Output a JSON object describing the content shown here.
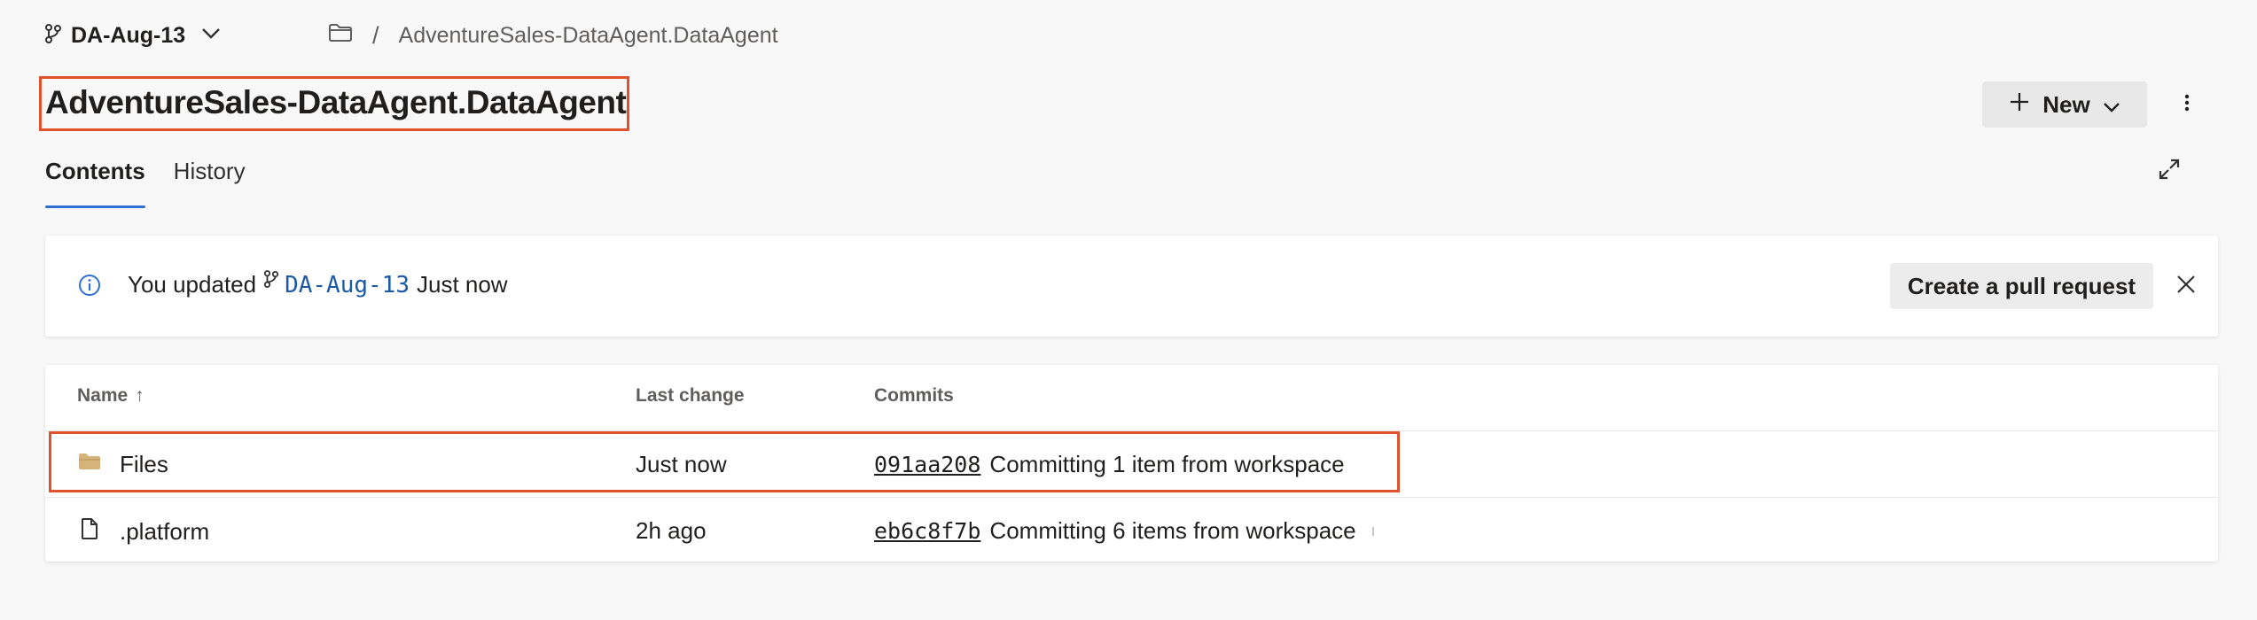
{
  "top": {
    "branch_name": "DA-Aug-13",
    "breadcrumb_separator": "/",
    "breadcrumb_item": "AdventureSales-DataAgent.DataAgent"
  },
  "header": {
    "title": "AdventureSales-DataAgent.DataAgent",
    "new_label": "New"
  },
  "tabs": [
    {
      "label": "Contents",
      "active": true
    },
    {
      "label": "History",
      "active": false
    }
  ],
  "banner": {
    "prefix": "You updated",
    "branch": "DA‐Aug‐13",
    "suffix": "Just now",
    "pr_button": "Create a pull request"
  },
  "table": {
    "columns": [
      "Name",
      "Last change",
      "Commits"
    ],
    "sort_indicator": "↑",
    "rows": [
      {
        "name": "Files",
        "type": "folder",
        "last_change": "Just now",
        "hash": "091aa208",
        "message": "Committing 1 item from workspace"
      },
      {
        "name": ".platform",
        "type": "file",
        "last_change": "2h ago",
        "hash": "eb6c8f7b",
        "message": "Committing 6 items from workspace"
      }
    ]
  },
  "colors": {
    "accent": "#2f6fd1",
    "highlight_box": "#e0512f",
    "folder": "#d6b37a",
    "info_icon": "#2f6fd1"
  }
}
